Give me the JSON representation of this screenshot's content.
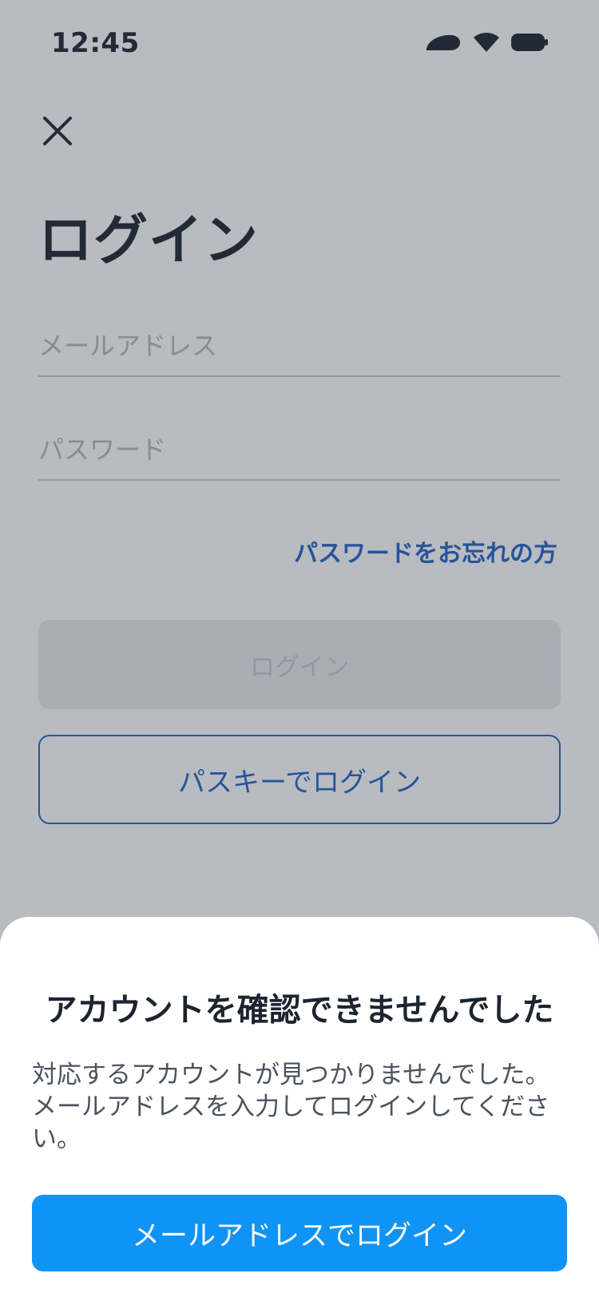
{
  "status_bar": {
    "time": "12:45",
    "icons": [
      "signal-icon",
      "wifi-icon",
      "battery-icon"
    ]
  },
  "header": {
    "close_icon": "close-icon"
  },
  "login_form": {
    "title": "ログイン",
    "email_placeholder": "メールアドレス",
    "email_value": "",
    "password_placeholder": "パスワード",
    "password_value": "",
    "forgot_password_label": "パスワードをお忘れの方",
    "login_button_label": "ログイン",
    "passkey_button_label": "パスキーでログイン"
  },
  "bottom_sheet": {
    "title": "アカウントを確認できませんでした",
    "message": "対応するアカウントが見つかりませんでした。メールアドレスを入力してログインしてください。",
    "email_login_button_label": "メールアドレスでログイン"
  },
  "colors": {
    "accent_blue": "#2463c4",
    "primary_button": "#0f93f5",
    "text_dark": "#1c2430",
    "disabled_button": "#e9ebee"
  }
}
